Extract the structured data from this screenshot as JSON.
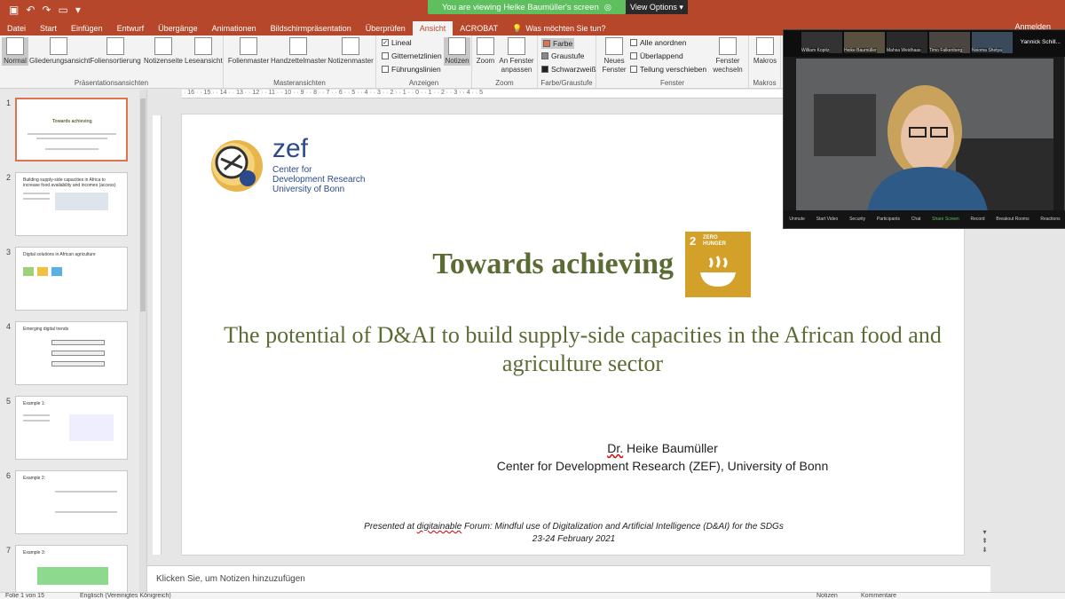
{
  "banner": {
    "viewing": "You are viewing Heike Baumüller's screen",
    "view_options": "View Options"
  },
  "tabs": [
    "Datei",
    "Start",
    "Einfügen",
    "Entwurf",
    "Übergänge",
    "Animationen",
    "Bildschirmpräsentation",
    "Überprüfen",
    "Ansicht",
    "ACROBAT"
  ],
  "active_tab": "Ansicht",
  "tell_me": "Was möchten Sie tun?",
  "signin": "Anmelden",
  "ribbon": {
    "views": [
      "Normal",
      "Gliederungsansicht",
      "Foliensortierung",
      "Notizenseite",
      "Leseansicht"
    ],
    "views_label": "Präsentationsansichten",
    "masters": [
      "Folienmaster",
      "Handzettelmaster",
      "Notizenmaster"
    ],
    "masters_label": "Masteransichten",
    "show": [
      "Lineal",
      "Gitternetzlinien",
      "Führungslinien"
    ],
    "show_label": "Anzeigen",
    "notes": "Notizen",
    "zoom": "Zoom",
    "fit": "An Fenster anpassen",
    "zoom_label": "Zoom",
    "color": [
      "Farbe",
      "Graustufe",
      "Schwarzweiß"
    ],
    "color_label": "Farbe/Graustufe",
    "new_window": "Neues Fenster",
    "window_items": [
      "Alle anordnen",
      "Überlappend",
      "Teilung verschieben"
    ],
    "switch": "Fenster wechseln",
    "window_label": "Fenster",
    "macros": "Makros",
    "macros_label": "Makros"
  },
  "thumbnails": [
    {
      "num": "1",
      "title": "Towards achieving"
    },
    {
      "num": "2",
      "title": "Building supply-side capacities in Africa to increase food availability and incomes (access)"
    },
    {
      "num": "3",
      "title": "Digital solutions in African agriculture"
    },
    {
      "num": "4",
      "title": "Emerging digital trends"
    },
    {
      "num": "5",
      "title": "Example 1:"
    },
    {
      "num": "6",
      "title": "Example 2:"
    },
    {
      "num": "7",
      "title": "Example 3:"
    }
  ],
  "slide": {
    "logo_word": "zef",
    "logo_sub": [
      "Center for",
      "Development Research",
      "University of Bonn"
    ],
    "title": "Towards achieving",
    "sdg_num": "2",
    "sdg_label": "ZERO HUNGER",
    "subtitle": "The potential of D&AI to build supply-side capacities in the African food and agriculture sector",
    "author_prefix": "Dr.",
    "author_name": "Heike Baumüller",
    "affiliation": "Center for Development Research (ZEF), University of Bonn",
    "footer_prefix": "Presented at",
    "footer_brand": "digitainable",
    "footer_rest": "Forum: Mindful use of Digitalization and Artificial Intelligence (D&AI) for the SDGs",
    "footer_date": "23-24 February 2021"
  },
  "notes_placeholder": "Klicken Sie, um Notizen hinzuzufügen",
  "status": {
    "slide": "Folie 1 von 15",
    "lang": "Englisch (Vereinigtes Königreich)",
    "notes": "Notizen",
    "comments": "Kommentare"
  },
  "zoom_participants": [
    "William Kopitz",
    "Heike Baumüller",
    "Mahsa Weidhaas",
    "Martin Gawrik",
    "Timo Falkenberg",
    "Nsioma Shetya"
  ],
  "zoom_extra": "Yannick Schill...",
  "zoom_controls": [
    "Unmute",
    "Start Video",
    "Security",
    "Participants",
    "Chat",
    "Share Screen",
    "Record",
    "Breakout Rooms",
    "Reactions"
  ]
}
